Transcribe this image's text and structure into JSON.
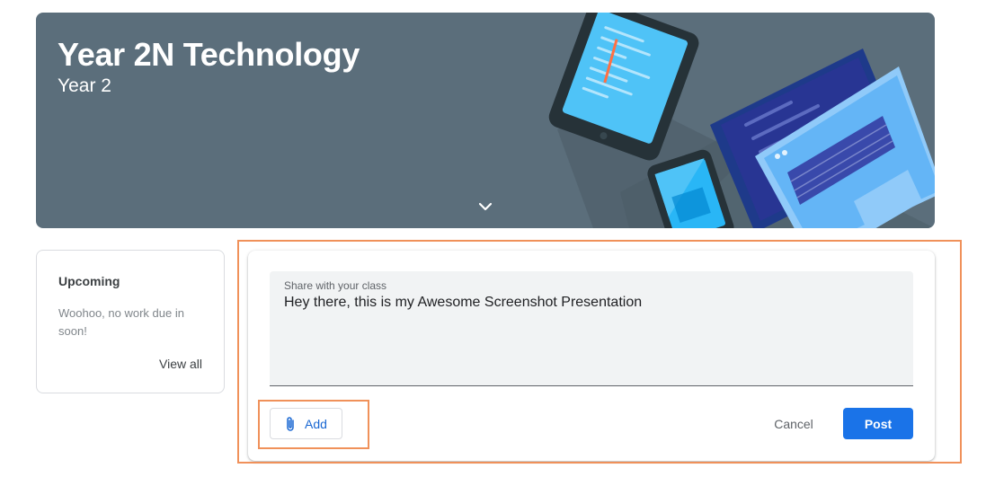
{
  "banner": {
    "title": "Year 2N Technology",
    "subtitle": "Year 2",
    "expand_icon": "chevron-down-icon"
  },
  "upcoming": {
    "title": "Upcoming",
    "message": "Woohoo, no work due in soon!",
    "view_all_label": "View all"
  },
  "composer": {
    "label": "Share with your class",
    "value": "Hey there, this is my Awesome Screenshot Presentation",
    "add_label": "Add",
    "add_icon": "paperclip-icon",
    "cancel_label": "Cancel",
    "post_label": "Post"
  },
  "colors": {
    "banner_bg": "#5b6e7b",
    "accent": "#1a73e8",
    "highlight": "#f0915a"
  }
}
